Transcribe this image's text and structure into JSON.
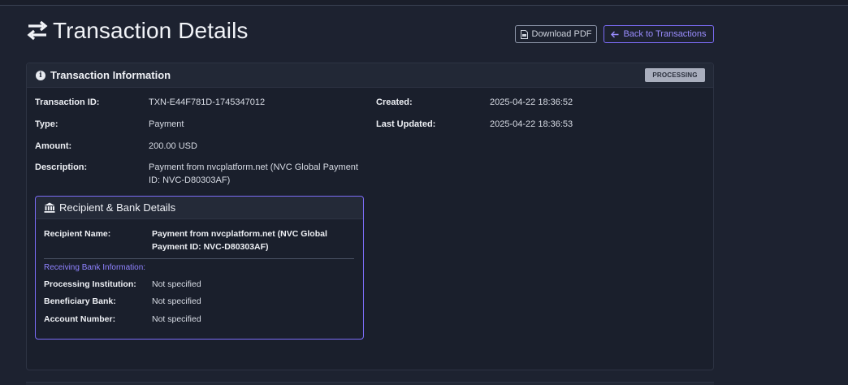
{
  "page": {
    "title": "Transaction Details",
    "title_icon": "swap-arrows-icon"
  },
  "actions": {
    "download_pdf": "Download PDF",
    "back": "Back to Transactions"
  },
  "transaction_info": {
    "header": "Transaction Information",
    "status": "PROCESSING",
    "fields": {
      "id_label": "Transaction ID:",
      "id_value": "TXN-E44F781D-1745347012",
      "type_label": "Type:",
      "type_value": "Payment",
      "amount_label": "Amount:",
      "amount_value": "200.00 USD",
      "description_label": "Description:",
      "description_value": "Payment from nvcplatform.net (NVC Global Payment ID: NVC-D80303AF)",
      "created_label": "Created:",
      "created_value": "2025-04-22 18:36:52",
      "updated_label": "Last Updated:",
      "updated_value": "2025-04-22 18:36:53"
    }
  },
  "recipient": {
    "header": "Recipient & Bank Details",
    "name_label": "Recipient Name:",
    "name_value": "Payment from nvcplatform.net (NVC Global Payment ID: NVC-D80303AF)",
    "bank_section_label": "Receiving Bank Information:",
    "institution_label": "Processing Institution:",
    "institution_value": "Not specified",
    "beneficiary_label": "Beneficiary Bank:",
    "beneficiary_value": "Not specified",
    "account_label": "Account Number:",
    "account_value": "Not specified"
  },
  "colors": {
    "background": "#1d2230",
    "accent": "#7b6cf6",
    "badge": "#a9aebd"
  }
}
